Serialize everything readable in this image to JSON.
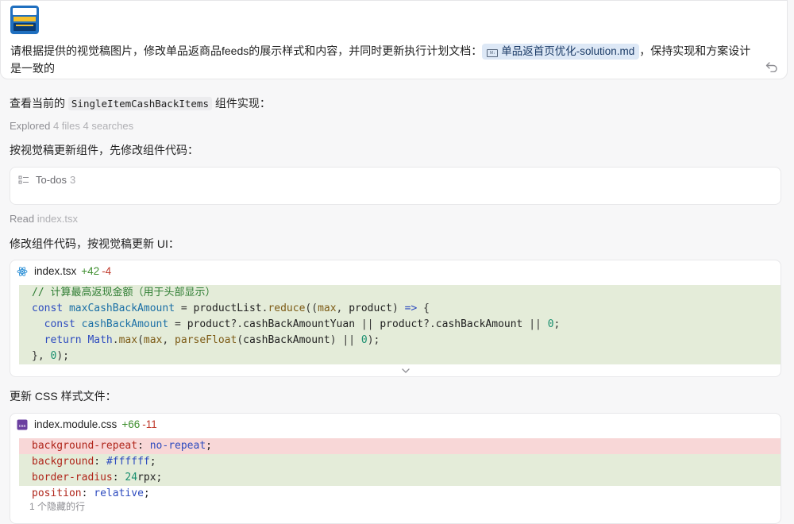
{
  "user_message": {
    "text_before": "请根据提供的视觉稿图片，修改单品返商品feeds的展示样式和内容，并同时更新执行计划文档：",
    "file_chip": "单品返首页优化-solution.md",
    "file_chip_icon": "markdown-file-icon",
    "text_after": "，保持实现和方案设计是一致的"
  },
  "assistant": {
    "line1_prefix": "查看当前的",
    "line1_code": "SingleItemCashBackItems",
    "line1_suffix": "组件实现：",
    "explored_label": "Explored",
    "explored_detail": "4 files 4 searches",
    "line2": "按视觉稿更新组件，先修改组件代码：",
    "todo": {
      "label": "To-dos",
      "count": "3"
    },
    "read_label": "Read",
    "read_file": "index.tsx",
    "line3": "修改组件代码，按视觉稿更新 UI：",
    "line4": "更新 CSS 样式文件："
  },
  "diff_tsx": {
    "file_name": "index.tsx",
    "added": "+42",
    "removed": "-4",
    "lines": [
      "// 计算最高返现金额（用于头部显示）",
      "const maxCashBackAmount = productList.reduce((max, product) => {",
      "  const cashBackAmount = product?.cashBackAmountYuan || product?.cashBackAmount || 0;",
      "  return Math.max(max, parseFloat(cashBackAmount) || 0);",
      "}, 0);"
    ]
  },
  "diff_css": {
    "file_name": "index.module.css",
    "added": "+66",
    "removed": "-11",
    "lines": [
      "background-repeat: no-repeat;",
      "background: #ffffff;",
      "border-radius: 24rpx;",
      "position: relative;"
    ],
    "hidden_rows": "1 个隐藏的行"
  },
  "colors": {
    "added_bg": "#e4ecd9",
    "removed_bg": "#f8d7d7",
    "chip_bg": "#dde8f6"
  }
}
